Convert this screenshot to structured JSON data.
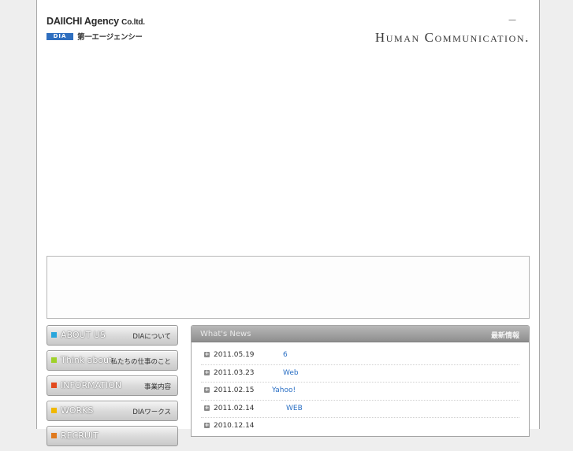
{
  "header": {
    "logo_title": "DAIICHI Agency",
    "logo_title_suffix": "Co.ltd.",
    "logo_badge": "DIA",
    "logo_jp": "第一エージェンシー",
    "dash": "—",
    "tagline": "Human Communication."
  },
  "nav": {
    "items": [
      {
        "en": "ABOUT US",
        "jp": "DIAについて",
        "color": "#2aa6dc"
      },
      {
        "en": "Think about",
        "jp": "私たちの仕事のこと",
        "color": "#9fd12a"
      },
      {
        "en": "INFORMATION",
        "jp": "事業内容",
        "color": "#e24a1e"
      },
      {
        "en": "WORKS",
        "jp": "DIAワークス",
        "color": "#f0b800"
      },
      {
        "en": "RECRUIT",
        "jp": "",
        "color": "#e07a1e"
      }
    ]
  },
  "news": {
    "title": "What's News",
    "title_jp": "最新情報",
    "items": [
      {
        "date": "2011.05.19",
        "text": "6"
      },
      {
        "date": "2011.03.23",
        "text": "Web"
      },
      {
        "date": "2011.02.15",
        "text": "Yahoo!"
      },
      {
        "date": "2011.02.14",
        "text": "WEB"
      },
      {
        "date": "2010.12.14",
        "text": ""
      }
    ]
  }
}
